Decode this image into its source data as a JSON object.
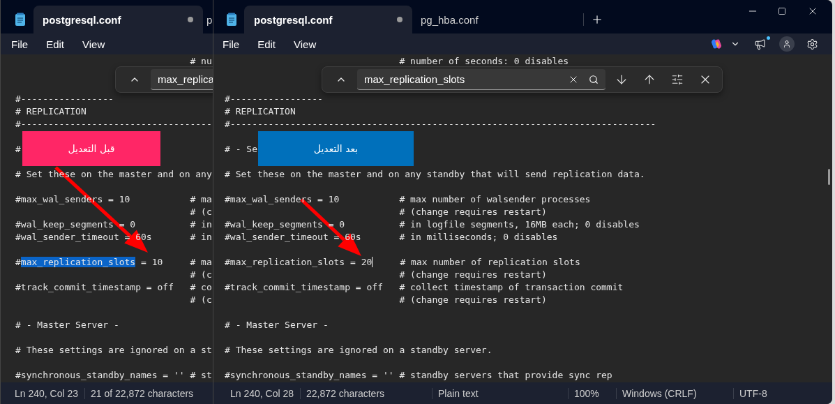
{
  "windows": [
    {
      "kind": "back",
      "tabs": [
        {
          "label": "postgresql.conf",
          "selected": true,
          "modified": true
        },
        {
          "label": "p",
          "selected": false,
          "modified": false
        }
      ],
      "menu": [
        {
          "label": "File"
        },
        {
          "label": "Edit"
        },
        {
          "label": "View"
        }
      ],
      "find": {
        "value": "max_replica"
      },
      "lines": [
        {
          "kind": "text",
          "text": "                                # nu"
        },
        {
          "kind": "blank"
        },
        {
          "kind": "blank"
        },
        {
          "kind": "text",
          "text": "#-----------------"
        },
        {
          "kind": "text",
          "text": "# REPLICATION"
        },
        {
          "kind": "text",
          "text": "#-----------------------------------"
        },
        {
          "kind": "blank"
        },
        {
          "kind": "text",
          "text": "#"
        },
        {
          "kind": "blank"
        },
        {
          "kind": "text",
          "text": "# Set these on the master and on any"
        },
        {
          "kind": "blank"
        },
        {
          "kind": "text",
          "text": "#max_wal_senders = 10           # ma"
        },
        {
          "kind": "text",
          "text": "                                # (c"
        },
        {
          "kind": "text",
          "text": "#wal_keep_segments = 0          # in"
        },
        {
          "kind": "text",
          "text": "#wal_sender_timeout = 60s       # in"
        },
        {
          "kind": "blank"
        },
        {
          "kind": "segments",
          "segments": [
            {
              "text": "#",
              "selected": false,
              "caret": false
            },
            {
              "text": "max_replication_slots",
              "selected": true,
              "caret": false
            },
            {
              "text": " = 10     # ma",
              "selected": false,
              "caret": false
            }
          ]
        },
        {
          "kind": "text",
          "text": "                                # (c"
        },
        {
          "kind": "text",
          "text": "#track_commit_timestamp = off   # co"
        },
        {
          "kind": "text",
          "text": "                                # (c"
        },
        {
          "kind": "blank"
        },
        {
          "kind": "text",
          "text": "# - Master Server -"
        },
        {
          "kind": "blank"
        },
        {
          "kind": "text",
          "text": "# These settings are ignored on a st"
        },
        {
          "kind": "blank"
        },
        {
          "kind": "text",
          "text": "#synchronous_standby_names = '' # st"
        }
      ],
      "status": [
        "Ln 240, Col 23",
        "21 of 22,872 characters"
      ],
      "note": {
        "text": "قبل التعديل",
        "color": "#ff2666"
      }
    },
    {
      "kind": "front",
      "tabs": [
        {
          "label": "postgresql.conf",
          "selected": true,
          "modified": true
        },
        {
          "label": "pg_hba.conf",
          "selected": false,
          "modified": false
        }
      ],
      "menu": [
        {
          "label": "File"
        },
        {
          "label": "Edit"
        },
        {
          "label": "View"
        }
      ],
      "find": {
        "value": "max_replication_slots"
      },
      "lines": [
        {
          "kind": "text",
          "text": "                                # number of seconds: 0 disables"
        },
        {
          "kind": "blank"
        },
        {
          "kind": "blank"
        },
        {
          "kind": "text",
          "text": "#-----------------"
        },
        {
          "kind": "text",
          "text": "# REPLICATION"
        },
        {
          "kind": "text",
          "text": "#------------------------------------------------------------------------------"
        },
        {
          "kind": "blank"
        },
        {
          "kind": "text",
          "text": "# - Se"
        },
        {
          "kind": "blank"
        },
        {
          "kind": "text",
          "text": "# Set these on the master and on any standby that will send replication data."
        },
        {
          "kind": "blank"
        },
        {
          "kind": "text",
          "text": "#max_wal_senders = 10           # max number of walsender processes"
        },
        {
          "kind": "text",
          "text": "                                # (change requires restart)"
        },
        {
          "kind": "text",
          "text": "#wal_keep_segments = 0          # in logfile segments, 16MB each; 0 disables"
        },
        {
          "kind": "text",
          "text": "#wal_sender_timeout = 60s       # in milliseconds; 0 disables"
        },
        {
          "kind": "blank"
        },
        {
          "kind": "segments",
          "segments": [
            {
              "text": "#max_replication_slots = 20",
              "selected": false,
              "caret": true
            },
            {
              "text": "     # max number of replication slots",
              "selected": false,
              "caret": false
            }
          ]
        },
        {
          "kind": "text",
          "text": "                                # (change requires restart)"
        },
        {
          "kind": "text",
          "text": "#track_commit_timestamp = off   # collect timestamp of transaction commit"
        },
        {
          "kind": "text",
          "text": "                                # (change requires restart)"
        },
        {
          "kind": "blank"
        },
        {
          "kind": "text",
          "text": "# - Master Server -"
        },
        {
          "kind": "blank"
        },
        {
          "kind": "text",
          "text": "# These settings are ignored on a standby server."
        },
        {
          "kind": "blank"
        },
        {
          "kind": "text",
          "text": "#synchronous_standby_names = '' # standby servers that provide sync rep"
        }
      ],
      "status": [
        "Ln 240, Col 28",
        "22,872 characters",
        "Plain text",
        "100%",
        "Windows (CRLF)",
        "UTF-8"
      ],
      "note": {
        "text": "بعد التعديل",
        "color": "#0070bb"
      }
    }
  ]
}
